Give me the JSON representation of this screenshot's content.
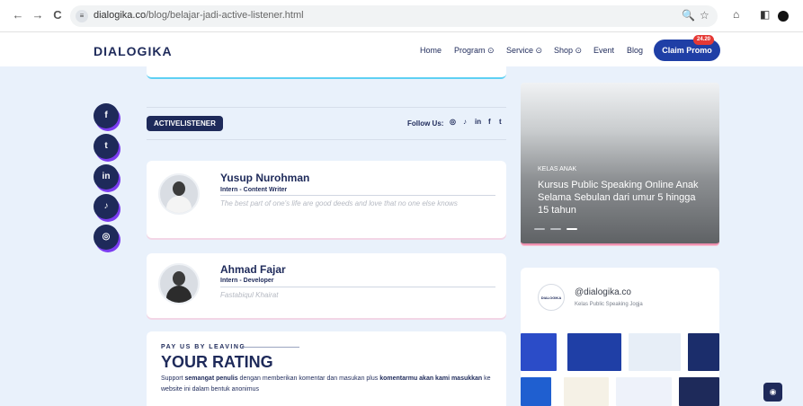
{
  "browser": {
    "back": "←",
    "forward": "→",
    "reload": "C",
    "url_host": "dialogika.co",
    "url_path": "/blog/belajar-jadi-active-listener.html"
  },
  "header": {
    "logo": "DIALOGIKA",
    "menu": [
      {
        "label": "Home"
      },
      {
        "label": "Program ⊙"
      },
      {
        "label": "Service ⊙"
      },
      {
        "label": "Shop ⊙"
      },
      {
        "label": "Event"
      },
      {
        "label": "Blog"
      }
    ],
    "claim_label": "Claim Promo",
    "promo_badge": "24.20"
  },
  "social": [
    "f",
    "t",
    "in",
    "♪",
    "◎"
  ],
  "tag_label": "ACTIVELISTENER",
  "follow_label": "Follow Us:",
  "follow_icons": [
    "◎",
    "♪",
    "in",
    "f",
    "t"
  ],
  "authors": [
    {
      "name": "Yusup Nurohman",
      "role": "Intern - Content Writer",
      "quote": "The best part of one's life are good deeds and love that no one else knows"
    },
    {
      "name": "Ahmad Fajar",
      "role": "Intern - Developer",
      "quote": "Fastabiqul Khairat"
    }
  ],
  "rating": {
    "kicker": "PAY US BY LEAVING",
    "title": "YOUR RATING",
    "text_1": "Support ",
    "text_2": "semangat penulis",
    "text_3": " dengan memberikan komentar dan masukan plus ",
    "text_4": "komentarmu akan kami masukkan",
    "text_5": " ke website ini dalam bentuk anonimus"
  },
  "course": {
    "category": "KELAS ANAK",
    "title": "Kursus Public Speaking Online Anak Selama Sebulan dari umur 5 hingga 15 tahun"
  },
  "instagram": {
    "avatar_text": "DIALOGIKA",
    "handle": "@dialogika.co",
    "subtitle": "Kelas Public Speaking Jogja",
    "tile_colors": [
      "#2b4cc8",
      "#1f3fa6",
      "#e7eef7",
      "#1b2d6b",
      "#1f5fd0",
      "#f5f1e6",
      "#eef2fa",
      "#1e2a5a"
    ]
  },
  "colors": {
    "navy": "#1e2a5a",
    "accent_blue": "#1f3fa6",
    "purple_shadow": "#7b3cf0"
  }
}
